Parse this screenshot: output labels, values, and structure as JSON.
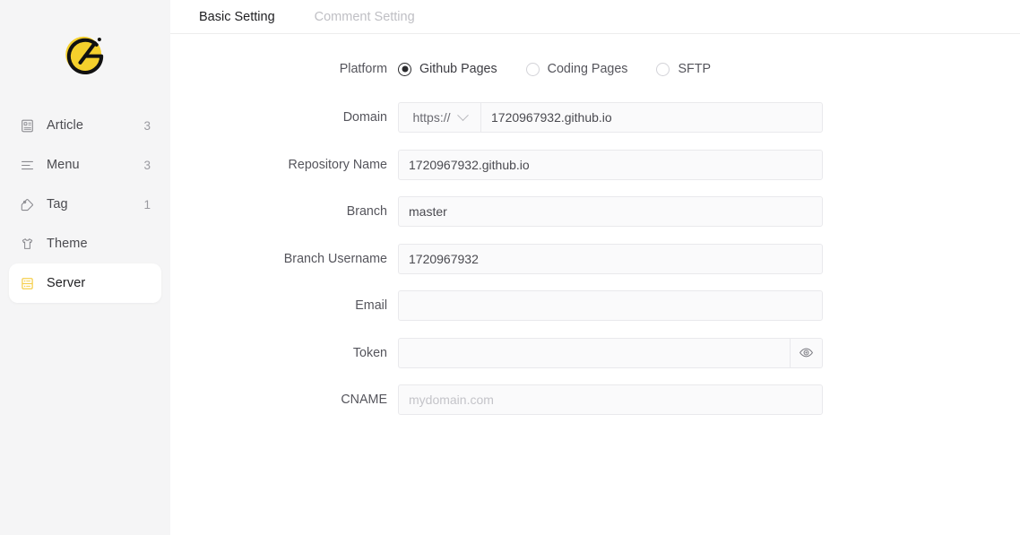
{
  "sidebar": {
    "logo": {
      "name": "gridea-logo",
      "bg_color": "#F5D02C",
      "mark_color": "#111111"
    },
    "items": [
      {
        "label": "Article",
        "count": "3",
        "icon": "article-icon",
        "active": false
      },
      {
        "label": "Menu",
        "count": "3",
        "icon": "menu-icon",
        "active": false
      },
      {
        "label": "Tag",
        "count": "1",
        "icon": "tag-icon",
        "active": false
      },
      {
        "label": "Theme",
        "count": "",
        "icon": "theme-icon",
        "active": false
      },
      {
        "label": "Server",
        "count": "",
        "icon": "server-icon",
        "active": true
      }
    ]
  },
  "tabs": [
    {
      "label": "Basic Setting",
      "active": true
    },
    {
      "label": "Comment Setting",
      "active": false
    }
  ],
  "form": {
    "platform": {
      "label": "Platform",
      "options": [
        {
          "label": "Github Pages",
          "selected": true
        },
        {
          "label": "Coding Pages",
          "selected": false
        },
        {
          "label": "SFTP",
          "selected": false
        }
      ]
    },
    "domain": {
      "label": "Domain",
      "protocol": "https://",
      "value": "1720967932.github.io",
      "placeholder": ""
    },
    "repository_name": {
      "label": "Repository Name",
      "value": "1720967932.github.io",
      "placeholder": ""
    },
    "branch": {
      "label": "Branch",
      "value": "master",
      "placeholder": ""
    },
    "branch_username": {
      "label": "Branch Username",
      "value": "1720967932",
      "placeholder": ""
    },
    "email": {
      "label": "Email",
      "value": "",
      "placeholder": ""
    },
    "token": {
      "label": "Token",
      "value": "",
      "placeholder": "",
      "reveal_icon": "eye-icon"
    },
    "cname": {
      "label": "CNAME",
      "value": "",
      "placeholder": "mydomain.com"
    }
  },
  "colors": {
    "accent": "#F5D02C",
    "sidebar_bg": "#F5F5F6",
    "input_bg": "#FAFAFB",
    "input_border": "#E9E9EC",
    "text": "#55555C",
    "text_muted": "#BFBFC4"
  }
}
